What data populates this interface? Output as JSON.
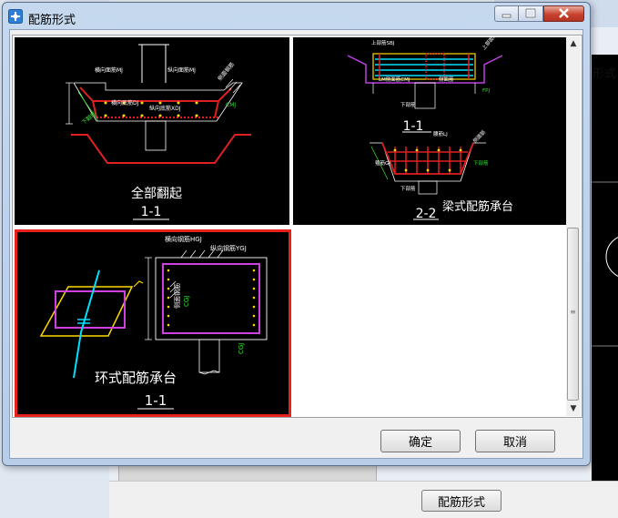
{
  "window": {
    "title": "配筋形式",
    "ok_label": "确定",
    "cancel_label": "取消"
  },
  "background": {
    "tab_text": "形式",
    "bottom_button_label": "配筋形式"
  },
  "options": [
    {
      "caption": "全部翻起",
      "section": "1-1",
      "labels": [
        "横向面筋MJ",
        "纵向面筋MJ",
        "横向底筋DJ",
        "纵向底筋XDJ",
        "侧面钢筋",
        "CMJ",
        "下翻筋"
      ]
    },
    {
      "caption": "梁式配筋承台",
      "section_top": "1-1",
      "section_bottom": "2-2",
      "labels": [
        "上部筋SBJ",
        "上部面筋",
        "LM侧面筋CMJ",
        "侧面筋",
        "箍筋GJ",
        "下部筋",
        "FPJ",
        "下部筋",
        "腰筋LJ",
        "侧面筋",
        "下部筋"
      ]
    },
    {
      "caption": "环式配筋承台",
      "section": "1-1",
      "selected": true,
      "labels": [
        "横向钢筋HGJ",
        "纵向钢筋YGJ",
        "侧面钢筋",
        "CGJ"
      ]
    }
  ],
  "colors": {
    "selection_border": "#e8211d",
    "drawing_background": "#000000"
  }
}
